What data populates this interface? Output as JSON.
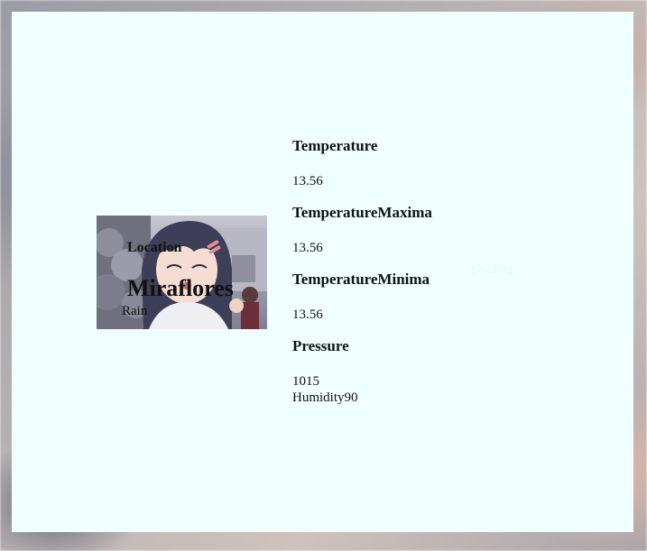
{
  "status": {
    "loading_text": "Loading"
  },
  "location": {
    "label": "Location",
    "city": "Miraflores",
    "condition": "Rain"
  },
  "stats": {
    "temperature_label": "Temperature",
    "temperature_value": "13.56",
    "temp_max_label": "TemperatureMaxima",
    "temp_max_value": "13.56",
    "temp_min_label": "TemperatureMinima",
    "temp_min_value": "13.56",
    "pressure_label": "Pressure",
    "pressure_value": "1015",
    "humidity_label": "Humidity",
    "humidity_value": "90"
  },
  "colors": {
    "card_background": "#f0ffff",
    "text": "#111111"
  }
}
